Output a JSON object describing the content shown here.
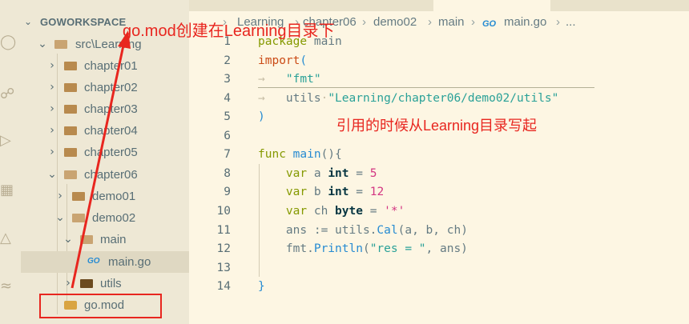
{
  "explorer": {
    "workspace_title": "GOWORKSPACE",
    "tree": [
      {
        "label": "src\\Learning",
        "kind": "folder",
        "state": "open"
      },
      {
        "label": "chapter01",
        "kind": "folder",
        "state": "closed"
      },
      {
        "label": "chapter02",
        "kind": "folder",
        "state": "closed"
      },
      {
        "label": "chapter03",
        "kind": "folder",
        "state": "closed"
      },
      {
        "label": "chapter04",
        "kind": "folder",
        "state": "closed"
      },
      {
        "label": "chapter05",
        "kind": "folder",
        "state": "closed"
      },
      {
        "label": "chapter06",
        "kind": "folder",
        "state": "open"
      },
      {
        "label": "demo01",
        "kind": "folder",
        "state": "closed"
      },
      {
        "label": "demo02",
        "kind": "folder",
        "state": "open"
      },
      {
        "label": "main",
        "kind": "folder",
        "state": "open"
      },
      {
        "label": "main.go",
        "kind": "go-file",
        "selected": true
      },
      {
        "label": "utils",
        "kind": "folder",
        "state": "closed"
      },
      {
        "label": "go.mod",
        "kind": "mod-file"
      }
    ]
  },
  "breadcrumb": {
    "items": [
      "Learning",
      "chapter06",
      "demo02",
      "main",
      "main.go",
      "..."
    ],
    "separator": "›",
    "file_icon": "GO"
  },
  "editor": {
    "line_numbers": [
      "1",
      "2",
      "3",
      "4",
      "5",
      "6",
      "7",
      "8",
      "9",
      "10",
      "11",
      "12",
      "13",
      "14"
    ],
    "code": {
      "l1_kw": "package",
      "l1_rest": " main",
      "l2_kw": "import",
      "l2_paren": "(",
      "l3_str": "\"fmt\"",
      "l4_name": "utils",
      "l4_str": "\"Learning/chapter06/demo02/utils\"",
      "l5_paren": ")",
      "l7_kw": "func",
      "l7_name": "main",
      "l7_rest": "(){",
      "l8_kw": "var",
      "l8_name": " a ",
      "l8_type": "int",
      "l8_eq": " = ",
      "l8_num": "5",
      "l9_kw": "var",
      "l9_name": " b ",
      "l9_type": "int",
      "l9_eq": " = ",
      "l9_num": "12",
      "l10_kw": "var",
      "l10_name": " ch ",
      "l10_type": "byte",
      "l10_eq": " = ",
      "l10_str": "'*'",
      "l11_pre": "ans := utils.",
      "l11_fn": "Cal",
      "l11_post": "(a, b, ch)",
      "l12_pre": "fmt.",
      "l12_fn": "Println",
      "l12_mid": "(",
      "l12_str": "\"res = \"",
      "l12_post": ", ans)",
      "l14_brace": "}"
    }
  },
  "annotations": {
    "gomod_note": "go.mod创建在Learning目录下",
    "import_note": "引用的时候从Learning目录写起",
    "color": "#e8261f"
  },
  "icons": {
    "activity_bar": [
      "search-icon",
      "source-control-icon",
      "run-debug-icon",
      "extensions-icon",
      "testing-icon",
      "remote-icon"
    ],
    "folder": "folder-icon",
    "go_file": "go-file-icon",
    "mod_file": "go-mod-icon"
  }
}
